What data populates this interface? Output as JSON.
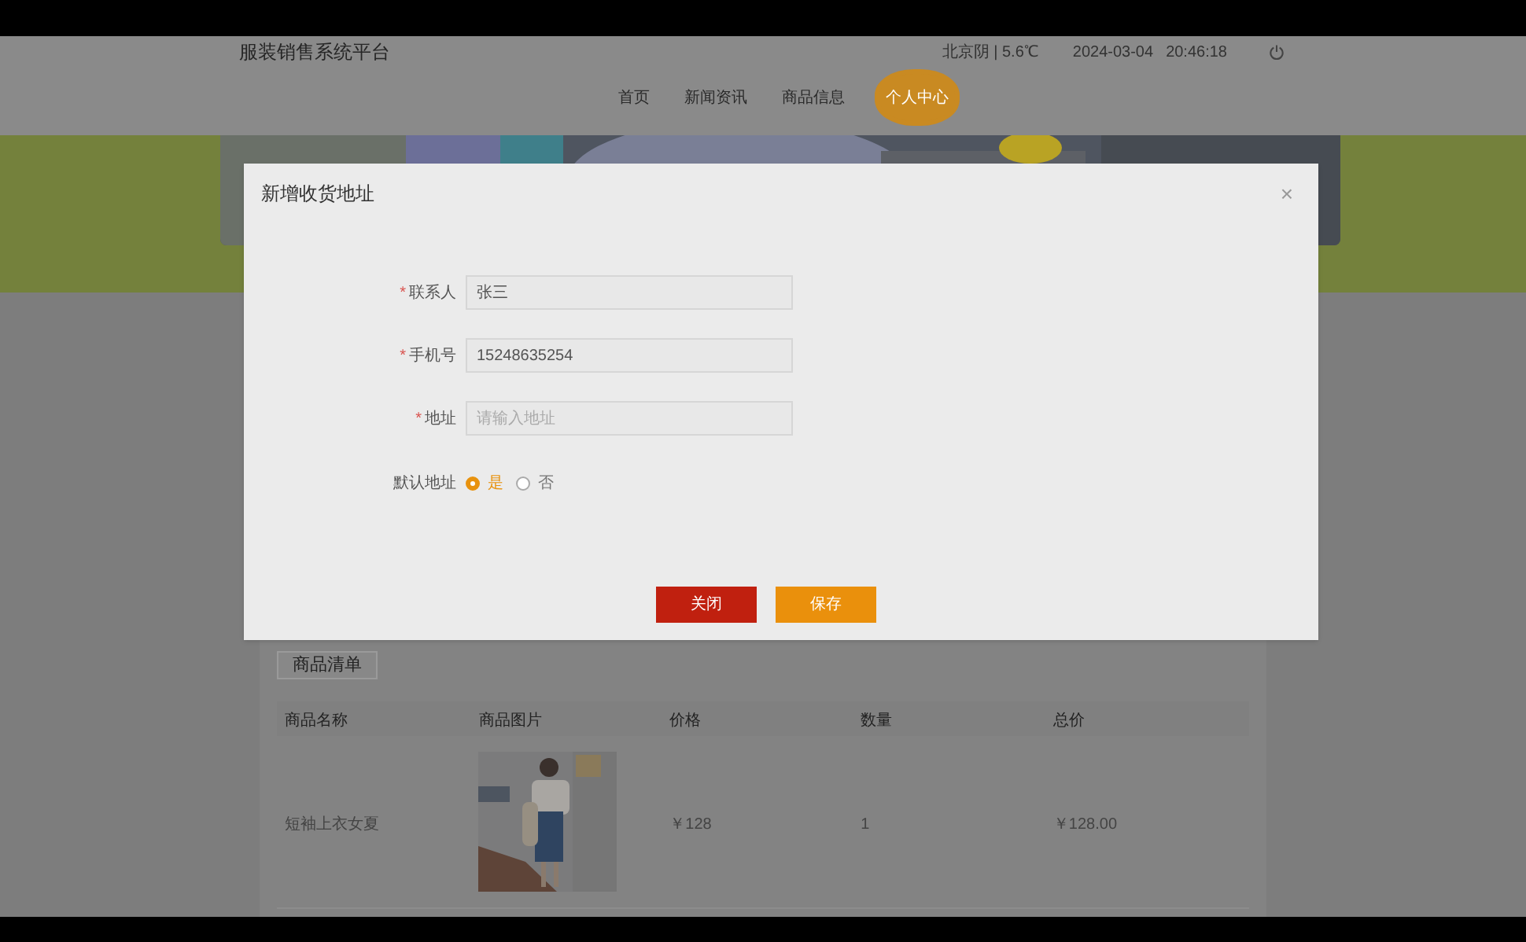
{
  "header": {
    "title": "服装销售系统平台",
    "weather": "北京阴 | 5.6℃",
    "date": "2024-03-04",
    "time": "20:46:18"
  },
  "nav": [
    {
      "label": "首页",
      "selected": false
    },
    {
      "label": "新闻资讯",
      "selected": false
    },
    {
      "label": "商品信息",
      "selected": false
    },
    {
      "label": "个人中心",
      "selected": true
    }
  ],
  "dialog": {
    "title": "新增收货地址",
    "close": "×",
    "fields": [
      {
        "required_mark": "*",
        "label": "联系人",
        "value": "张三"
      },
      {
        "required_mark": "*",
        "label": "手机号",
        "value": "15248635254"
      },
      {
        "required_mark": "*",
        "label": "地址",
        "placeholder": "请输入地址"
      }
    ],
    "default_address": {
      "label": "默认地址",
      "options": [
        {
          "label": "是",
          "selected": true
        },
        {
          "label": "否",
          "selected": false
        }
      ]
    },
    "buttons": [
      {
        "label": "关闭",
        "kind": "danger"
      },
      {
        "label": "保存",
        "kind": "primary"
      }
    ]
  },
  "order": {
    "tab_button": "商品清单",
    "table": {
      "columns": [
        "商品名称",
        "商品图片",
        "价格",
        "数量",
        "总价"
      ],
      "rows": [
        {
          "name": "短袖上衣女夏",
          "price": "￥128",
          "quantity": "1",
          "total": "￥128.00"
        }
      ]
    }
  }
}
